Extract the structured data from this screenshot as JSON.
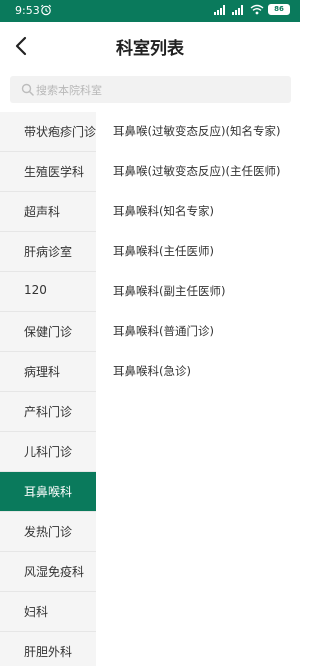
{
  "status_bar": {
    "time": "9:53",
    "battery": "86"
  },
  "header": {
    "title": "科室列表"
  },
  "search": {
    "placeholder": "搜索本院科室"
  },
  "sidebar": {
    "items": [
      {
        "label": "带状疱疹门诊"
      },
      {
        "label": "生殖医学科"
      },
      {
        "label": "超声科"
      },
      {
        "label": "肝病诊室"
      },
      {
        "label": "120"
      },
      {
        "label": "保健门诊"
      },
      {
        "label": "病理科"
      },
      {
        "label": "产科门诊"
      },
      {
        "label": "儿科门诊"
      },
      {
        "label": "耳鼻喉科",
        "active": true
      },
      {
        "label": "发热门诊"
      },
      {
        "label": "风湿免疫科"
      },
      {
        "label": "妇科"
      },
      {
        "label": "肝胆外科"
      }
    ]
  },
  "departments": [
    "耳鼻喉(过敏变态反应)(知名专家)",
    "耳鼻喉(过敏变态反应)(主任医师)",
    "耳鼻喉科(知名专家)",
    "耳鼻喉科(主任医师)",
    "耳鼻喉科(副主任医师)",
    "耳鼻喉科(普通门诊)",
    "耳鼻喉科(急诊)"
  ],
  "colors": {
    "primary": "#0a7a5c",
    "sidebar_bg": "#f5f5f5"
  }
}
